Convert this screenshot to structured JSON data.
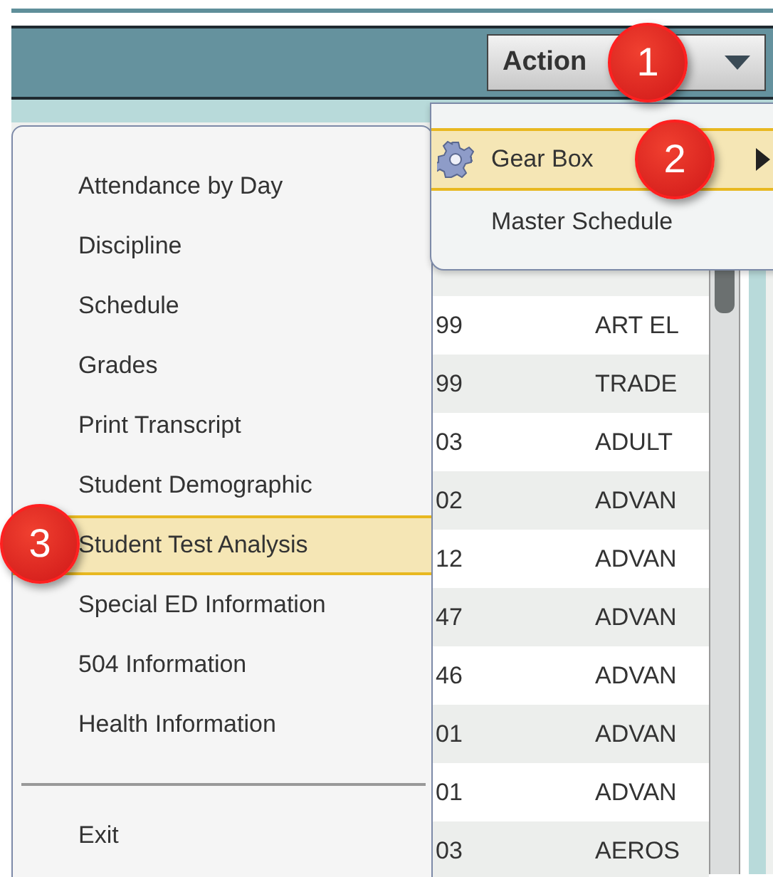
{
  "toolbar": {
    "action_button": "Action"
  },
  "table": {
    "rows": [
      {
        "column_1": "99",
        "column_2": "ART EL"
      },
      {
        "column_1": "99",
        "column_2": "TRADE"
      },
      {
        "column_1": "03",
        "column_2": "ADULT"
      },
      {
        "column_1": "02",
        "column_2": "ADVAN"
      },
      {
        "column_1": "12",
        "column_2": "ADVAN"
      },
      {
        "column_1": "47",
        "column_2": "ADVAN"
      },
      {
        "column_1": "46",
        "column_2": "ADVAN"
      },
      {
        "column_1": "01",
        "column_2": "ADVAN"
      },
      {
        "column_1": "01",
        "column_2": "ADVAN"
      },
      {
        "column_1": "03",
        "column_2": "AEROS"
      }
    ]
  },
  "dropdown_menu": {
    "items": [
      {
        "label": "Gear Box",
        "kind": "submenu",
        "selected": true
      },
      {
        "label": "Master Schedule",
        "kind": "plain",
        "selected": false
      }
    ]
  },
  "side_menu": {
    "items": [
      {
        "label": "Attendance by Day",
        "selected": false
      },
      {
        "label": "Discipline",
        "selected": false
      },
      {
        "label": "Schedule",
        "selected": false
      },
      {
        "label": "Grades",
        "selected": false
      },
      {
        "label": "Print Transcript",
        "selected": false
      },
      {
        "label": "Student Demographic",
        "selected": false
      },
      {
        "label": "Student Test Analysis",
        "selected": true
      },
      {
        "label": "Special ED Information",
        "selected": false
      },
      {
        "label": "504 Information",
        "selected": false
      },
      {
        "label": "Health Information",
        "selected": false
      }
    ],
    "footer_items": [
      {
        "label": "Exit",
        "selected": false
      }
    ]
  },
  "callouts": [
    {
      "number": "1"
    },
    {
      "number": "2"
    },
    {
      "number": "3"
    }
  ]
}
